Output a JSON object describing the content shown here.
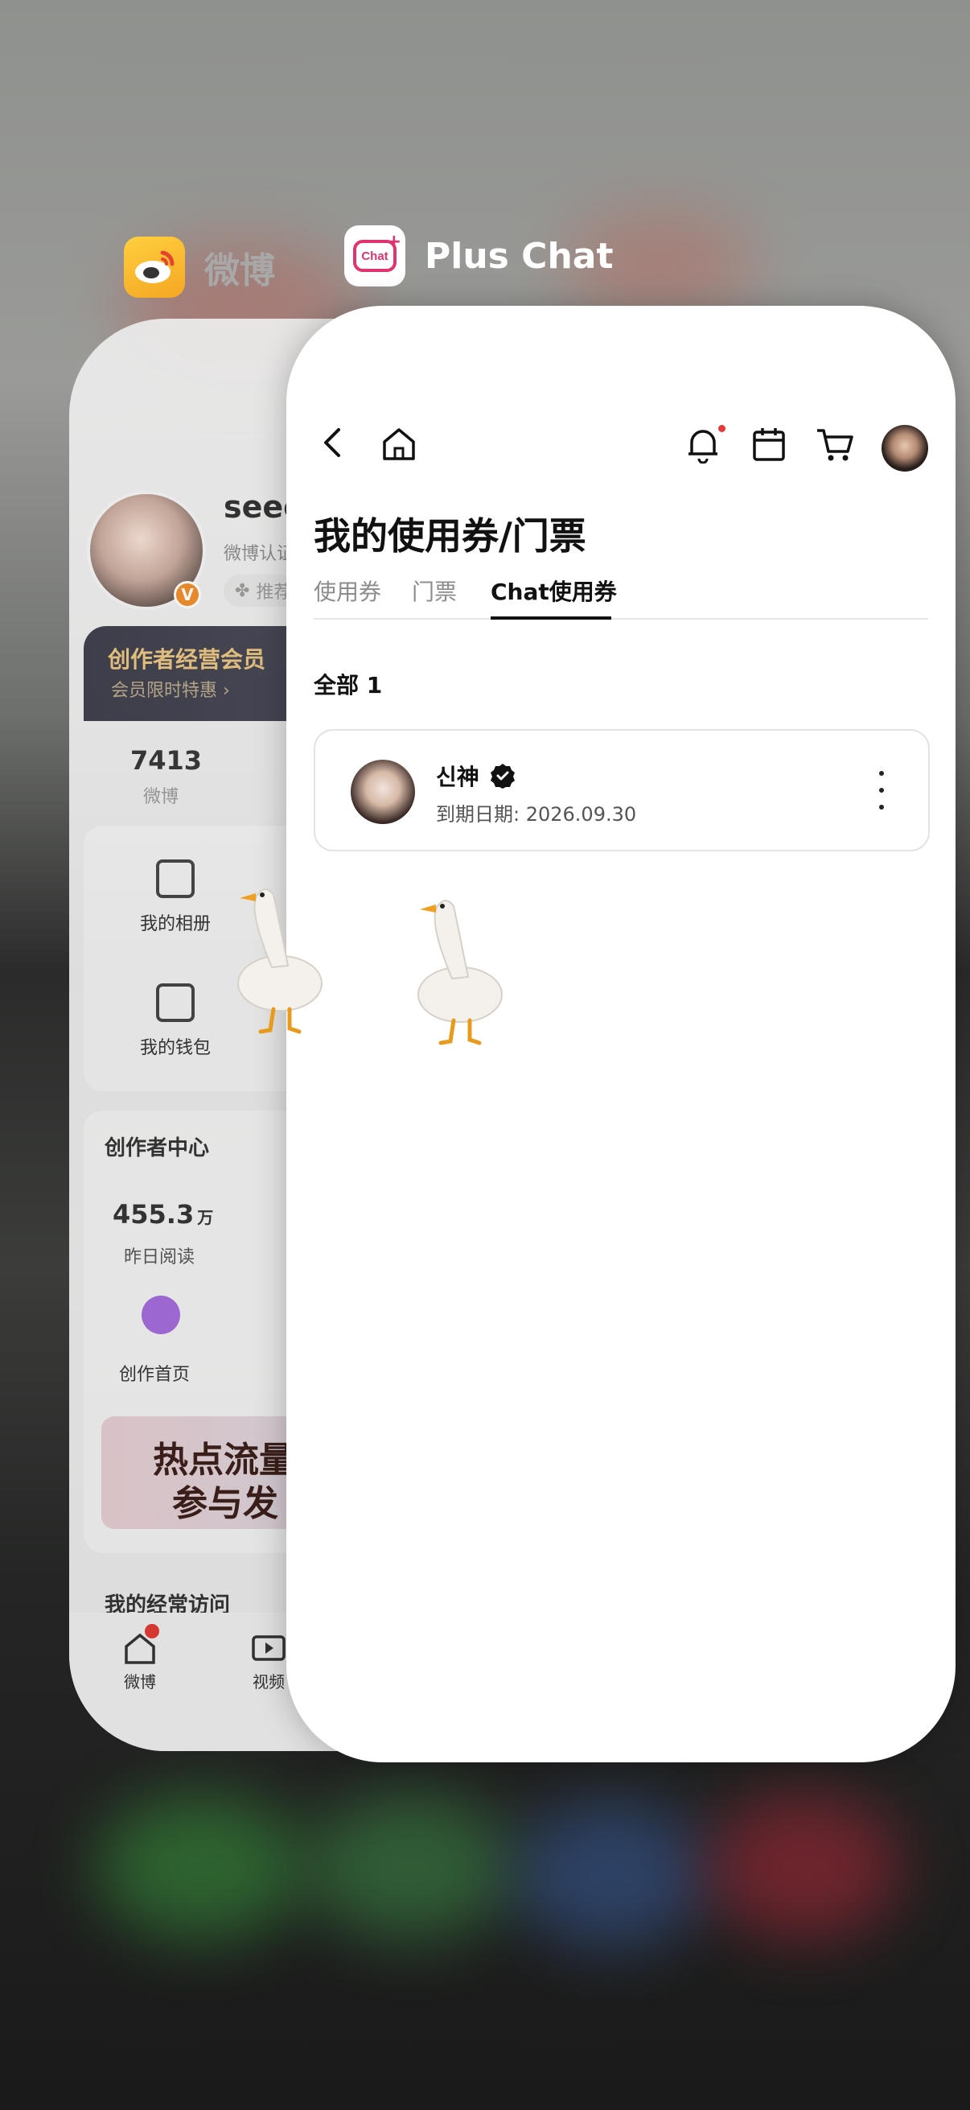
{
  "app_switcher": {
    "weibo_app_name": "微博",
    "chat_app_name": "Plus Chat",
    "chat_icon_text": "Chat"
  },
  "weibo_card": {
    "username": "seee",
    "subtitle": "微博认证",
    "tag": "推荐",
    "banner_title": "创作者经营会员",
    "banner_sub": "会员限时特惠 ›",
    "stat_weibo_num": "7413",
    "stat_weibo_label": "微博",
    "grid": [
      "我的相册",
      "我的钱包"
    ],
    "creator_title": "创作者中心",
    "read_num": "455.3",
    "read_unit": "万",
    "read_label": "昨日阅读",
    "creator_home": "创作首页",
    "promo_line1": "热点流量",
    "promo_line2": "参与发",
    "frequent": "我的经常访问",
    "tab_home": "微博",
    "tab_video": "视频"
  },
  "chat_card": {
    "page_title": "我的使用券/门票",
    "tabs": [
      "使用券",
      "门票",
      "Chat使用券"
    ],
    "active_tab": "Chat使用券",
    "count_label": "全部 1",
    "ticket": {
      "name": "신神",
      "expire": "到期日期: 2026.09.30"
    }
  },
  "colors": {
    "accent": "#111111",
    "notification_dot": "#e53935",
    "chat_brand": "#e0336f"
  }
}
